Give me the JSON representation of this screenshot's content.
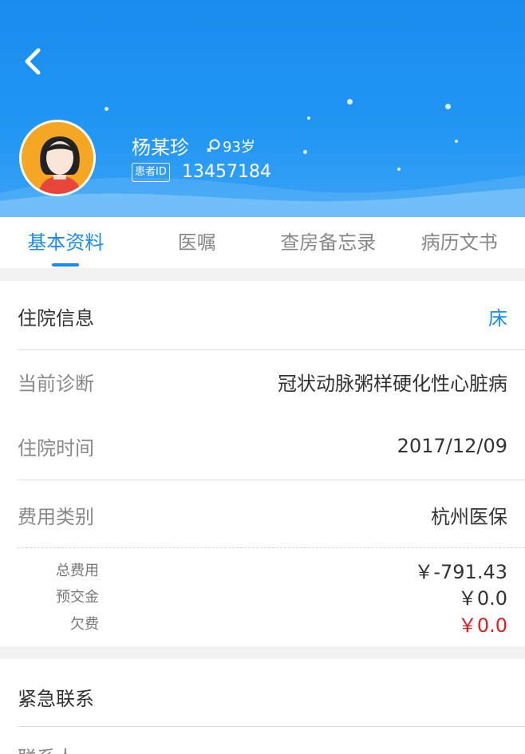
{
  "header": {
    "patient_name": "杨某珍",
    "age": "93岁",
    "id_label": "患者ID",
    "patient_id": "13457184",
    "colors": {
      "bg": "#1a8cf0",
      "accent": "#1a8cf0",
      "red": "#e02020"
    }
  },
  "tabs": [
    {
      "label": "基本资料",
      "active": true
    },
    {
      "label": "医嘱",
      "active": false
    },
    {
      "label": "查房备忘录",
      "active": false
    },
    {
      "label": "病历文书",
      "active": false
    }
  ],
  "admission": {
    "title": "住院信息",
    "bed_label": "床",
    "diagnosis_label": "当前诊断",
    "diagnosis_value": "冠状动脉粥样硬化性心脏病",
    "admit_time_label": "住院时间",
    "admit_time_value": "2017/12/09",
    "fee_type_label": "费用类别",
    "fee_type_value": "杭州医保"
  },
  "fees": {
    "total_label": "总费用",
    "total_value": "￥-791.43",
    "deposit_label": "预交金",
    "deposit_value": "￥0.0",
    "arrears_label": "欠费",
    "arrears_value": "￥0.0"
  },
  "emergency": {
    "title": "紧急联系",
    "first_row_label": "联系人"
  },
  "icons": [
    "back-arrow-icon",
    "female-icon",
    "avatar-female"
  ]
}
